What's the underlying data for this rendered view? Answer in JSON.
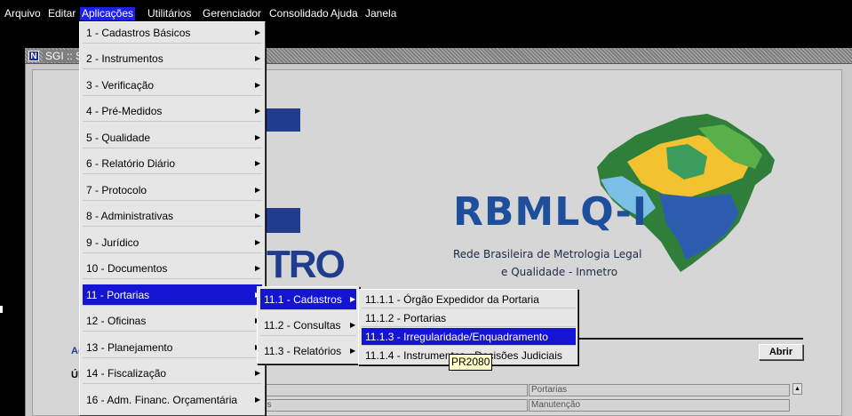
{
  "menubar": {
    "items": [
      "Arquivo",
      "Editar",
      "Aplicações",
      "Utilitários",
      "Gerenciador",
      "Consolidado",
      "Ajuda",
      "Janela"
    ]
  },
  "window": {
    "title": "SGI :: S",
    "icon_letter": "N"
  },
  "background": {
    "logo_fragment": "TRO",
    "rbmlq_title": "RBMLQ-I",
    "rbmlq_subtitle_1": "Rede Brasileira de Metrologia Legal",
    "rbmlq_subtitle_2": "e Qualidade - Inmetro",
    "section_fragment_1": "Ac",
    "section_fragment_2": "Últ",
    "open_button": "Abrir",
    "grid_values": [
      "Portarias",
      "Manutenção",
      "es"
    ]
  },
  "menu_aplicacoes": {
    "items": [
      "1 - Cadastros Básicos",
      "2 - Instrumentos",
      "3 - Verificação",
      "4 - Pré-Medidos",
      "5 - Qualidade",
      "6 - Relatório Diário",
      "7 - Protocolo",
      "8 - Administrativas",
      "9 - Jurídico",
      "10 - Documentos",
      "11 - Portarias",
      "12 - Oficinas",
      "13 - Planejamento",
      "14 - Fiscalização",
      "16 - Adm. Financ. Orçamentária"
    ],
    "selected": "11 - Portarias"
  },
  "menu_portarias": {
    "items": [
      "11.1 - Cadastros",
      "11.2 - Consultas",
      "11.3 - Relatórios"
    ],
    "selected": "11.1 - Cadastros"
  },
  "menu_cadastros": {
    "items": [
      "11.1.1 - Órgão Expedidor da Portaria",
      "11.1.2 - Portarias",
      "11.1.3 - Irregularidade/Enquadramento",
      "11.1.4 - Instrumentos - Decisões Judiciais"
    ],
    "selected": "11.1.3 - Irregularidade/Enquadramento"
  },
  "tooltip": "PR2080",
  "colors": {
    "menu_highlight": "#1414d2",
    "logo_blue": "#1f3d8c",
    "tooltip_bg": "#fffcc8"
  },
  "icons": [
    "submenu-arrow-icon",
    "window-app-icon",
    "scroll-up-icon"
  ]
}
